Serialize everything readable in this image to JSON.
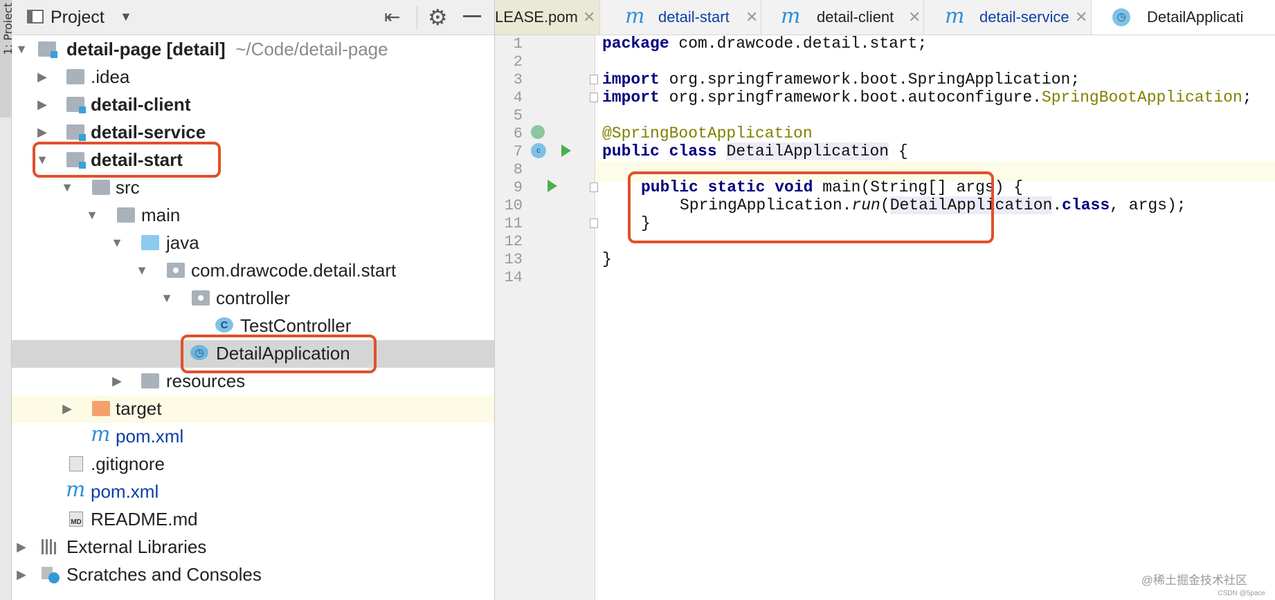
{
  "side_strip": {
    "label": "1: Project"
  },
  "project_panel": {
    "title": "Project",
    "tree": [
      {
        "id": "root",
        "label": "detail-page [detail]",
        "suffix": "~/Code/detail-page"
      },
      {
        "id": "idea",
        "label": ".idea"
      },
      {
        "id": "detail_client",
        "label": "detail-client"
      },
      {
        "id": "detail_service",
        "label": "detail-service"
      },
      {
        "id": "detail_start",
        "label": "detail-start"
      },
      {
        "id": "src",
        "label": "src"
      },
      {
        "id": "main",
        "label": "main"
      },
      {
        "id": "java",
        "label": "java"
      },
      {
        "id": "pkg",
        "label": "com.drawcode.detail.start"
      },
      {
        "id": "controller",
        "label": "controller"
      },
      {
        "id": "test_controller",
        "label": "TestController",
        "icon": "C"
      },
      {
        "id": "detail_application",
        "label": "DetailApplication"
      },
      {
        "id": "resources",
        "label": "resources"
      },
      {
        "id": "target",
        "label": "target"
      },
      {
        "id": "pom_inner",
        "label": "pom.xml",
        "icon": "m"
      },
      {
        "id": "gitignore",
        "label": ".gitignore"
      },
      {
        "id": "pom_root",
        "label": "pom.xml",
        "icon": "m"
      },
      {
        "id": "readme",
        "label": "README.md",
        "icon_text": "MD"
      },
      {
        "id": "ext_libs",
        "label": "External Libraries"
      },
      {
        "id": "scratches",
        "label": "Scratches and Consoles"
      }
    ]
  },
  "tabs": [
    {
      "label": "LEASE.pom",
      "close": "✕"
    },
    {
      "label": "detail-start",
      "icon": "m",
      "close": "✕"
    },
    {
      "label": "detail-client",
      "icon": "m",
      "close": "✕"
    },
    {
      "label": "detail-service",
      "icon": "m",
      "close": "✕"
    },
    {
      "label": "DetailApplicati"
    }
  ],
  "editor": {
    "line_numbers": [
      "1",
      "2",
      "3",
      "4",
      "5",
      "6",
      "7",
      "8",
      "9",
      "10",
      "11",
      "12",
      "13",
      "14"
    ],
    "code": {
      "l1_kw": "package",
      "l1_rest": " com.drawcode.detail.start;",
      "l3_kw": "import",
      "l3_rest": " org.springframework.boot.SpringApplication;",
      "l4_kw": "import",
      "l4_rest": " org.springframework.boot.autoconfigure.",
      "l4_ann": "SpringBootApplication",
      "l4_end": ";",
      "l6_ann": "@SpringBootApplication",
      "l7_kw": "public class",
      "l7_sp": " ",
      "l7_name": "DetailApplication",
      "l7_end": " {",
      "l9_kw": "public static void",
      "l9_rest": " main(String[] args) {",
      "l10_a": "SpringApplication.",
      "l10_run": "run",
      "l10_b": "(",
      "l10_name": "DetailApplication",
      "l10_c": ".",
      "l10_kw": "class",
      "l10_d": ", args);",
      "l11": "}",
      "l13": "}"
    }
  },
  "watermark": {
    "main": "@稀土掘金技术社区",
    "sub": "CSDN @5pace"
  },
  "colors": {
    "highlight_box": "#e0502b",
    "keyword": "#000080",
    "annotation": "#808000",
    "maven_icon": "#2f8fd8"
  }
}
